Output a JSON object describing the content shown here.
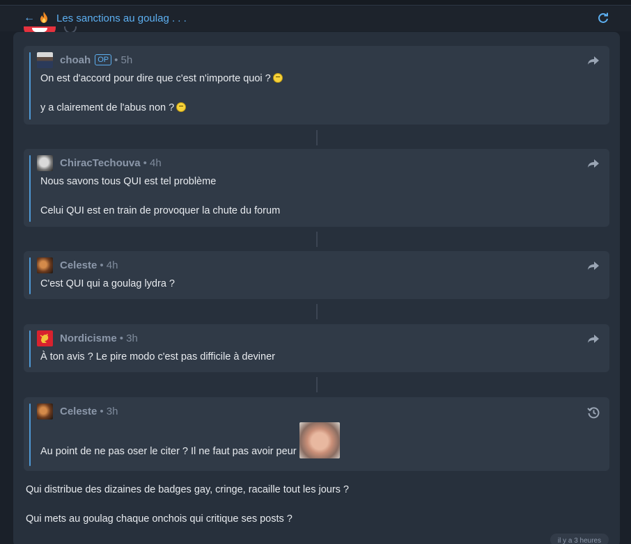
{
  "header": {
    "title": "Les sanctions au goulag . . ."
  },
  "quotes": [
    {
      "author": "choah",
      "op_badge": "OP",
      "time": "• 5h",
      "lines": [
        "On est d'accord pour dire que c'est n'importe quoi ?",
        "y a clairement de l'abus non ?"
      ],
      "action_icon": "share-arrow-icon"
    },
    {
      "author": "ChiracTechouva",
      "time": "• 4h",
      "lines": [
        "Nous savons tous QUI est tel problème",
        "Celui QUI est en train de provoquer la chute du forum"
      ],
      "action_icon": "share-arrow-icon"
    },
    {
      "author": "Celeste",
      "time": "• 4h",
      "lines": [
        "C'est QUI qui a goulag lydra ?"
      ],
      "action_icon": "share-arrow-icon"
    },
    {
      "author": "Nordicisme",
      "time": "• 3h",
      "lines": [
        "À ton avis ? Le pire modo c'est pas difficile à deviner"
      ],
      "action_icon": "share-arrow-icon"
    },
    {
      "author": "Celeste",
      "time": "• 3h",
      "lines": [
        "Au point de ne pas oser le citer ? Il ne faut pas avoir peur"
      ],
      "action_icon": "history-icon"
    }
  ],
  "body": {
    "lines": [
      "Qui distribue des dizaines de badges gay, cringe, racaille tout les jours ?",
      "Qui mets au goulag chaque onchois qui critique ses posts ?"
    ]
  },
  "footer": {
    "timestamp": "il y a 3 heures"
  },
  "colors": {
    "accent": "#5db0f2",
    "background": "#1a2029",
    "card": "#27303c",
    "quote": "#303a47"
  }
}
